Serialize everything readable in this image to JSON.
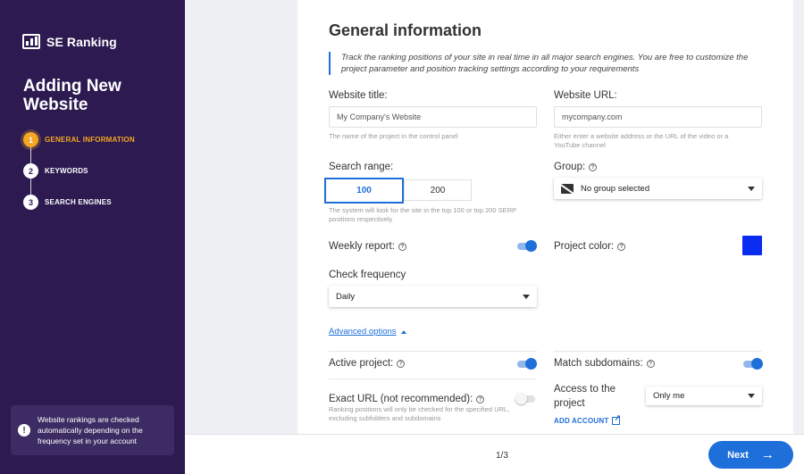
{
  "sidebar": {
    "brand": "SE Ranking",
    "title": "Adding New Website",
    "steps": [
      {
        "num": "1",
        "label": "GENERAL INFORMATION"
      },
      {
        "num": "2",
        "label": "KEYWORDS"
      },
      {
        "num": "3",
        "label": "SEARCH ENGINES"
      }
    ],
    "tip": "Website rankings are checked automatically depending on the frequency set in your account"
  },
  "main": {
    "heading": "General information",
    "intro": "Track the ranking positions of your site in real time in all major search engines. You are free to customize the project parameter and position tracking settings according to your requirements",
    "website_title": {
      "label": "Website title:",
      "value": "My Company's Website",
      "hint": "The name of the project in the control panel"
    },
    "website_url": {
      "label": "Website URL:",
      "value": "mycompany.com",
      "hint": "Either enter a website address or the URL of the video or a YouTube channel"
    },
    "search_range": {
      "label": "Search range:",
      "options": [
        "100",
        "200"
      ],
      "selected": "100",
      "hint": "The system will look for the site in the top 100 or top 200 SERP positions respectively"
    },
    "group": {
      "label": "Group:",
      "value": "No group selected"
    },
    "weekly_report": {
      "label": "Weekly report:",
      "on": true
    },
    "project_color": {
      "label": "Project color:",
      "color": "#0a2bf0"
    },
    "check_frequency": {
      "label": "Check frequency",
      "value": "Daily"
    },
    "advanced_options": "Advanced options",
    "active_project": {
      "label": "Active project:",
      "on": true
    },
    "match_subdomains": {
      "label": "Match subdomains:",
      "on": true
    },
    "exact_url": {
      "label": "Exact URL (not recommended):",
      "on": false,
      "hint": "Ranking positions will only be checked for the specified URL, excluding subfolders and subdomains"
    },
    "access": {
      "label": "Access to the project",
      "value": "Only me",
      "add_account": "ADD ACCOUNT"
    }
  },
  "footer": {
    "page": "1/3",
    "next": "Next"
  },
  "colors": {
    "sidebar_bg": "#2c1a51",
    "accent": "#1e6fd9",
    "active_step": "#f5a623"
  }
}
